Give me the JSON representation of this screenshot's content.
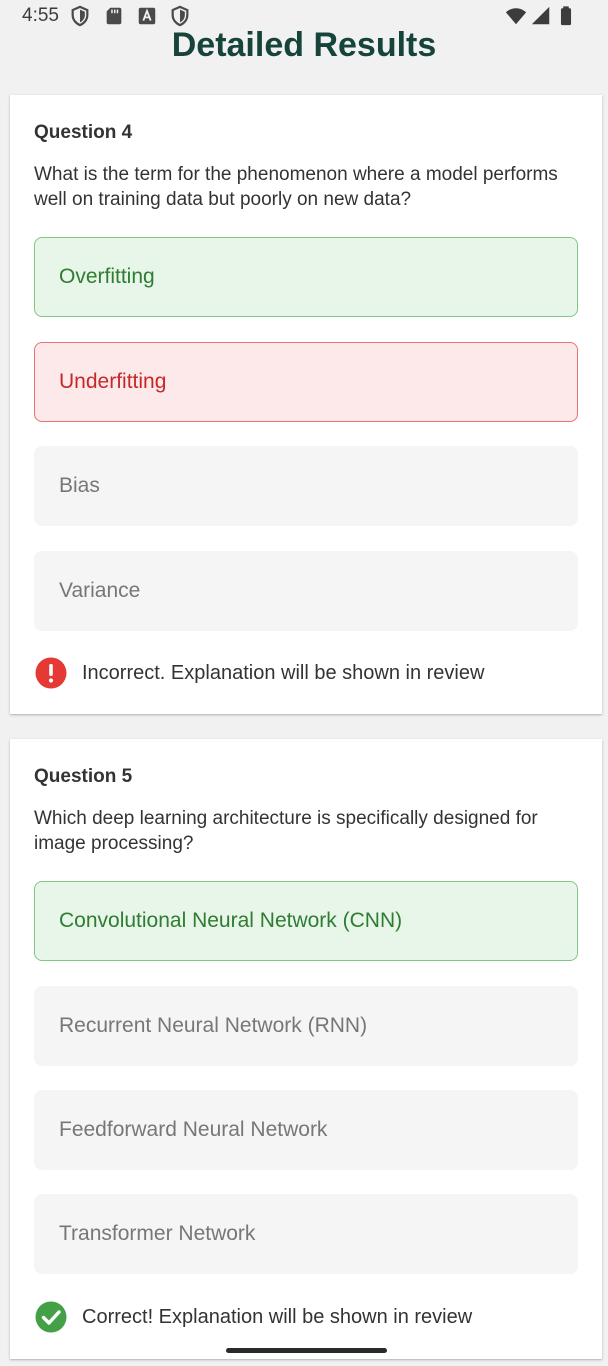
{
  "status_bar": {
    "time": "4:55",
    "left_icons": [
      "shield-icon",
      "sd-card-icon",
      "text-a-icon",
      "shield-icon"
    ],
    "right_icons": [
      "wifi-icon",
      "cellular-signal-icon",
      "battery-icon"
    ]
  },
  "header": {
    "title": "Detailed Results"
  },
  "questions": [
    {
      "label": "Question 4",
      "text": "What is the term for the phenomenon where a model performs well on training data but poorly on new data?",
      "options": [
        {
          "label": "Overfitting",
          "state": "correct"
        },
        {
          "label": "Underfitting",
          "state": "selected-incorrect"
        },
        {
          "label": "Bias",
          "state": "neutral"
        },
        {
          "label": "Variance",
          "state": "neutral"
        }
      ],
      "feedback": {
        "icon": "error-icon",
        "text": "Incorrect. Explanation will be shown in review"
      }
    },
    {
      "label": "Question 5",
      "text": "Which deep learning architecture is specifically designed for image processing?",
      "options": [
        {
          "label": "Convolutional Neural Network (CNN)",
          "state": "correct"
        },
        {
          "label": "Recurrent Neural Network (RNN)",
          "state": "neutral"
        },
        {
          "label": "Feedforward Neural Network",
          "state": "neutral"
        },
        {
          "label": "Transformer Network",
          "state": "neutral"
        }
      ],
      "feedback": {
        "icon": "check-circle-icon",
        "text": "Correct! Explanation will be shown in review"
      }
    }
  ],
  "colors": {
    "title": "#16443b",
    "correct_bg": "#e8f5e9",
    "correct_border": "#81c784",
    "correct_text": "#2e7d32",
    "wrong_bg": "#fde8ea",
    "wrong_border": "#e57373",
    "wrong_text": "#c62828",
    "error_icon": "#e53935",
    "success_icon": "#43a047"
  }
}
